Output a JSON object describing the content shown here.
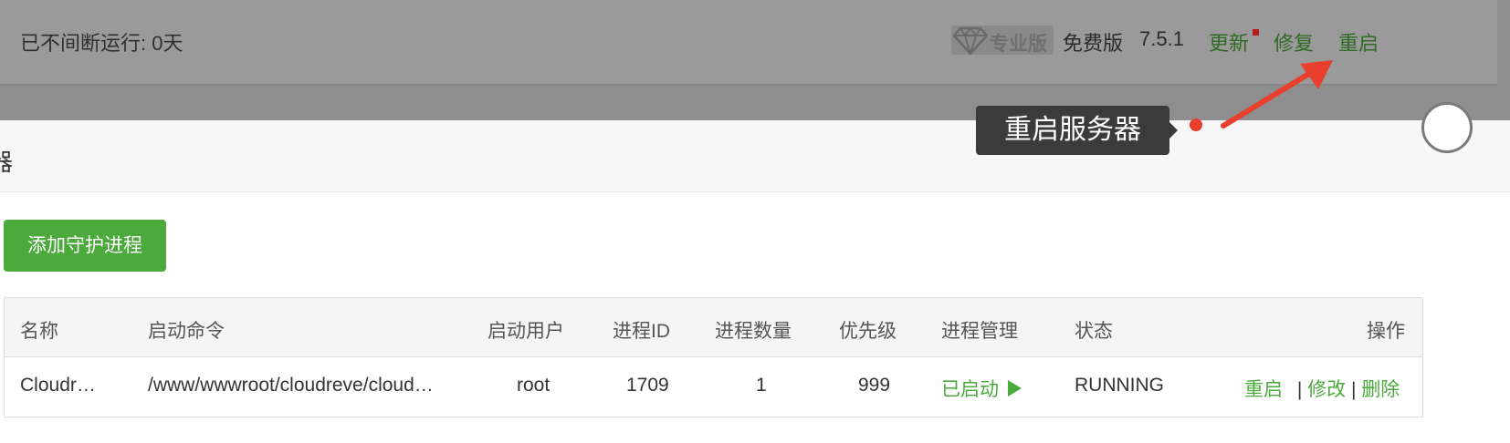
{
  "header": {
    "uptime": "已不间断运行: 0天",
    "pro_label": "专业版",
    "free_label": "免费版",
    "version": "7.5.1",
    "update_link": "更新",
    "repair_link": "修复",
    "restart_link": "重启"
  },
  "tooltip": {
    "text": "重启服务器"
  },
  "section": {
    "title": "器"
  },
  "toolbar": {
    "add_button": "添加守护进程"
  },
  "table": {
    "columns": [
      "名称",
      "启动命令",
      "启动用户",
      "进程ID",
      "进程数量",
      "优先级",
      "进程管理",
      "状态",
      "操作"
    ],
    "rows": [
      {
        "name": "Cloudr…",
        "command": "/www/wwwroot/cloudreve/cloud…",
        "user": "root",
        "pid": "1709",
        "count": "1",
        "priority": "999",
        "manage": "已启动",
        "status": "RUNNING",
        "actions": {
          "restart": "重启",
          "edit": "修改",
          "delete": "删除",
          "sep": "|"
        }
      }
    ]
  },
  "colors": {
    "accent_green": "#4caa3c",
    "link_green": "#2f6b22",
    "marker_red": "#e8402c"
  }
}
